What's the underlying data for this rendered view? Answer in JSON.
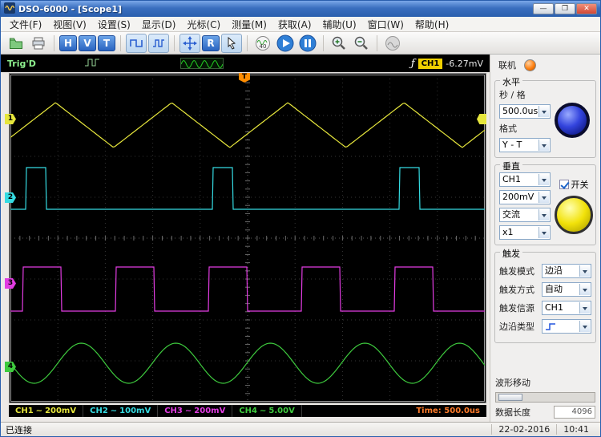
{
  "window": {
    "title": "DSO-6000 - [Scope1]",
    "icons": {
      "minimize": "—",
      "maximize": "❐",
      "close": "✕"
    }
  },
  "menu": {
    "items": [
      "文件(F)",
      "视图(V)",
      "设置(S)",
      "显示(D)",
      "光标(C)",
      "测量(M)",
      "获取(A)",
      "辅助(U)",
      "窗口(W)",
      "帮助(H)"
    ]
  },
  "toolbar": {
    "h": "H",
    "v": "V",
    "t": "T",
    "r": "R",
    "badge40": "40"
  },
  "trigger_bar": {
    "status": "Trig'D",
    "symbol": "ƒ",
    "channel": "CH1",
    "value": "-6.27mV"
  },
  "scope": {
    "trigger_marker": "T",
    "time": "Time: 500.0us",
    "channels": [
      {
        "num": "1",
        "label": "CH1",
        "coupling": "~",
        "scale": "200mV",
        "color": "#e6e63c"
      },
      {
        "num": "2",
        "label": "CH2",
        "coupling": "~",
        "scale": "100mV",
        "color": "#35dbe2"
      },
      {
        "num": "3",
        "label": "CH3",
        "coupling": "~",
        "scale": "200mV",
        "color": "#e23ce2"
      },
      {
        "num": "4",
        "label": "CH4",
        "coupling": "~",
        "scale": "5.00V",
        "color": "#3ecb3e"
      }
    ]
  },
  "panel": {
    "online_label": "联机",
    "horizontal": {
      "title": "水平",
      "secdiv_label": "秒 / 格",
      "secdiv_value": "500.0us",
      "format_label": "格式",
      "format_value": "Y - T"
    },
    "vertical": {
      "title": "垂直",
      "channel": "CH1",
      "switch_label": "开关",
      "scale": "200mV",
      "coupling": "交流",
      "probe": "x1"
    },
    "trigger": {
      "title": "触发",
      "mode_label": "触发模式",
      "mode_value": "边沿",
      "way_label": "触发方式",
      "way_value": "自动",
      "source_label": "触发信源",
      "source_value": "CH1",
      "edge_label": "边沿类型"
    },
    "wave": {
      "title": "波形移动",
      "datalen_label": "数据长度",
      "datalen_value": "4096"
    }
  },
  "statusbar": {
    "connected": "已连接",
    "date": "22-02-2016",
    "time": "10:41"
  },
  "chart_data": {
    "type": "line",
    "title": "oscilloscope traces",
    "time_per_div": "500.0us",
    "divisions": {
      "x": 10,
      "y": 8
    },
    "waveforms": [
      {
        "channel": "CH1",
        "shape": "triangle",
        "color": "#e6e63c",
        "period": 145,
        "phase": 20,
        "center": 63,
        "amp": 28
      },
      {
        "channel": "CH2",
        "shape": "pulse",
        "color": "#35dbe2",
        "period": 233,
        "rise": 20,
        "width": 25,
        "high": 116,
        "low": 168
      },
      {
        "channel": "CH3",
        "shape": "pulse",
        "color": "#e23ce2",
        "period": 116,
        "rise": 16,
        "width": 48,
        "high": 240,
        "low": 295
      },
      {
        "channel": "CH4",
        "shape": "sine",
        "color": "#3ecb3e",
        "period": 118,
        "phase": -59,
        "center": 360,
        "amp": 25
      }
    ]
  }
}
